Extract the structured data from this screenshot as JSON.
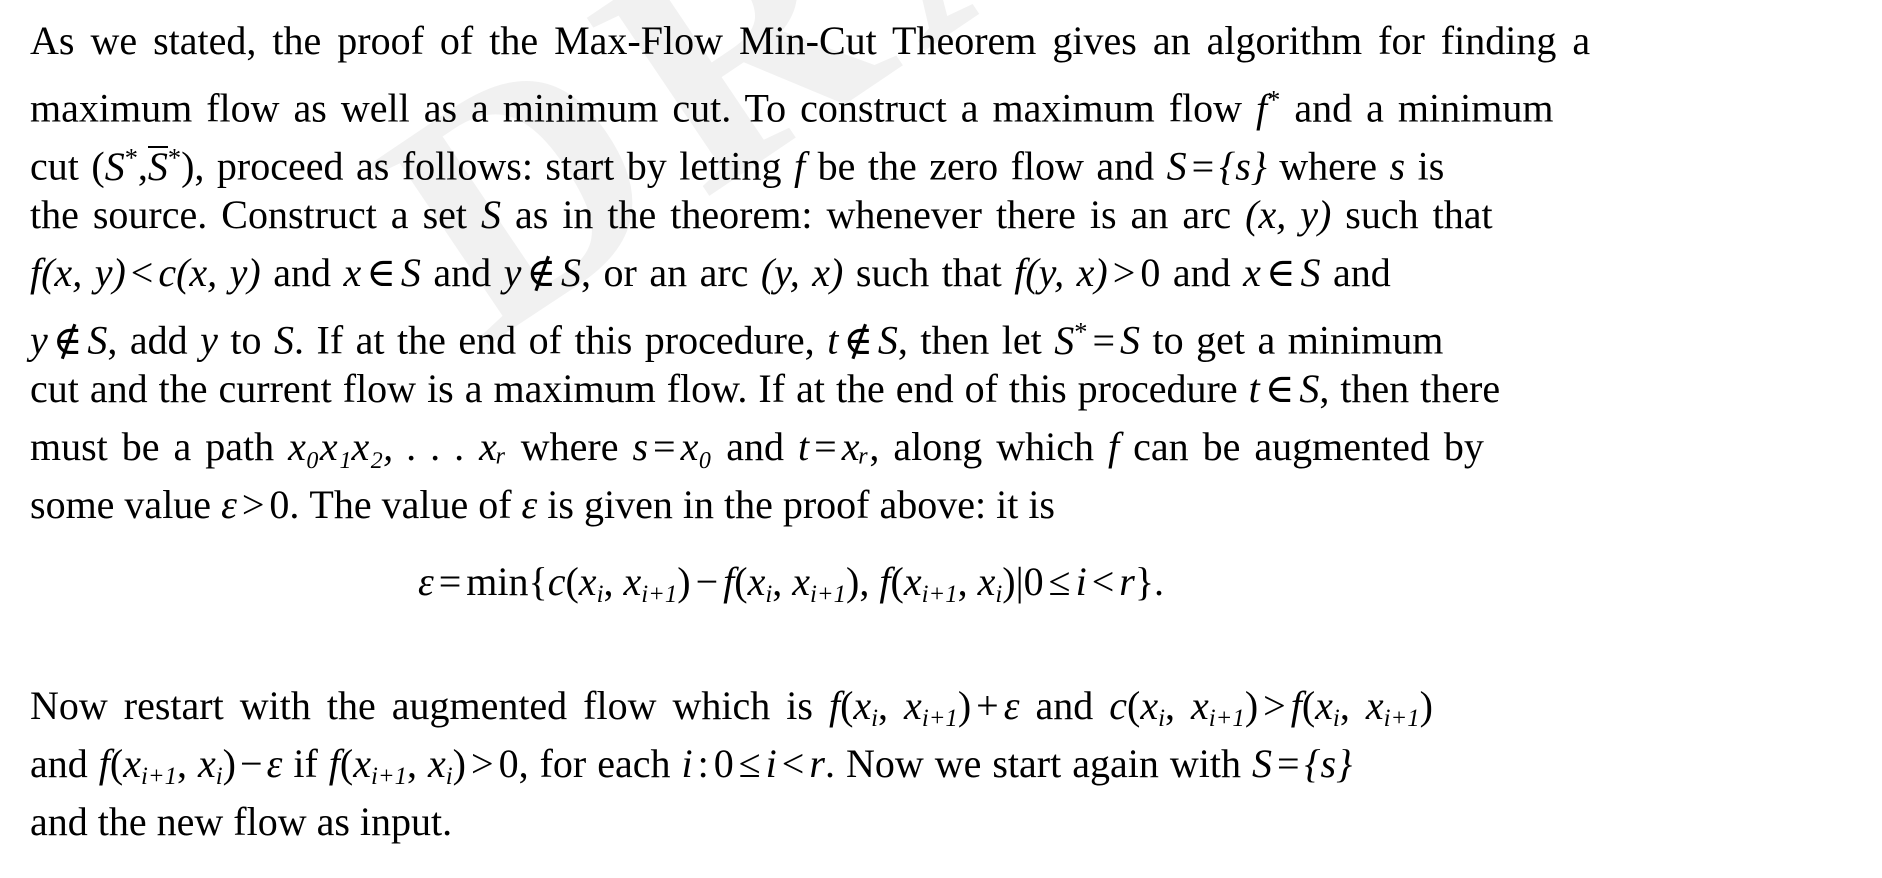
{
  "document": {
    "background_color": "#ffffff",
    "text_color": "#000000",
    "watermark": {
      "text": "DRAFT",
      "color": "#f1f1f1",
      "rotation_degrees": -34
    }
  },
  "paragraph_1": {
    "lines": [
      {
        "id": "p1-l1",
        "text": "As we stated, the proof of the Max-Flow Min-Cut Theorem gives an algorithm for finding a"
      },
      {
        "id": "p1-l2",
        "text": "maximum flow as well as a minimum cut. To construct a maximum flow f* and a minimum"
      },
      {
        "id": "p1-l3",
        "text": "cut (S*, S̅*), proceed as follows: start by letting f be the zero flow and S = {s} where s is"
      },
      {
        "id": "p1-l4",
        "text": "the source. Construct a set S as in the theorem: whenever there is an arc (x, y) such that"
      },
      {
        "id": "p1-l5",
        "text": "f(x, y) < c(x, y) and x ∈ S and y ∉ S, or an arc (y, x) such that f(y, x) > 0 and x ∈ S and"
      },
      {
        "id": "p1-l6",
        "text": "y ∉ S, add y to S. If at the end of this procedure, t ∉ S, then let S* = S to get a minimum"
      },
      {
        "id": "p1-l7",
        "text": "cut and the current flow is a maximum flow. If at the end of this procedure t ∈ S, then there"
      },
      {
        "id": "p1-l8",
        "text": "must be a path x₀x₁x₂, … xᵣ where s = x₀ and t = xᵣ, along which f can be augmented by"
      },
      {
        "id": "p1-l9",
        "text": "some value ε > 0. The value of ε is given in the proof above: it is"
      }
    ],
    "tokens": {
      "l1": {
        "t1": "As we stated, the proof of the Max-Flow Min-Cut Theorem gives an algorithm for finding a"
      },
      "l2": {
        "t1": "maximum flow as well as a minimum cut. To construct a maximum flow",
        "var_f": "f",
        "star": "*",
        "t2": "and a minimum"
      },
      "l3": {
        "t1": "cut (",
        "var_S1": "S",
        "star1": "*",
        "comma": ",",
        "var_S2": "S",
        "star2": "*",
        "t2": "), proceed as follows: start by letting",
        "var_f": "f",
        "t3": "be the zero flow and",
        "var_S3": "S",
        "eq": "=",
        "brace_s": "{s}",
        "t4": "where",
        "var_s": "s",
        "t5": "is"
      },
      "l4": {
        "t1": "the source.  Construct a set",
        "var_S": "S",
        "t2": "as in the theorem:  whenever there is an arc",
        "pair_xy": "(x, y)",
        "t3": "such that"
      },
      "l5": {
        "f_xy": "f(x, y)",
        "lt": "<",
        "c_xy": "c(x, y)",
        "t1": "and",
        "var_x": "x",
        "in1": "∈",
        "var_S1": "S",
        "t2": "and",
        "var_y": "y",
        "notin": "∉",
        "var_S2": "S",
        "t3": ", or an arc",
        "pair_yx": "(y, x)",
        "t4": "such that",
        "f_yx": "f(y, x)",
        "gt": ">",
        "zero": "0",
        "t5": "and",
        "var_x2": "x",
        "in2": "∈",
        "var_S3": "S",
        "t6": "and"
      },
      "l6": {
        "var_y": "y",
        "notin1": "∉",
        "var_S1": "S",
        "t1": ", add",
        "var_y2": "y",
        "t2": "to",
        "var_S2": "S",
        "t3": ". If at the end of this procedure,",
        "var_t": "t",
        "notin2": "∉",
        "var_S3": "S",
        "t4": ", then let",
        "var_Sstar": "S",
        "star": "*",
        "eq": "=",
        "var_S4": "S",
        "t5": "to get a minimum"
      },
      "l7": {
        "t1": "cut and the current flow is a maximum flow.  If at the end of this procedure",
        "var_t": "t",
        "in": "∈",
        "var_S": "S",
        "t2": ", then there"
      },
      "l8": {
        "t1": "must be a path",
        "path": "x₀x₁x₂, . . . xᵣ",
        "t2": "where",
        "var_s": "s",
        "eq1": "=",
        "x0": "x₀",
        "t3": "and",
        "var_t": "t",
        "eq2": "=",
        "xr": "xᵣ",
        "t4": ", along which",
        "var_f": "f",
        "t5": "can be augmented by"
      },
      "l9": {
        "t1": "some value",
        "eps1": "ε",
        "gt": ">",
        "zero": "0",
        "t2": ". The value of",
        "eps2": "ε",
        "t3": "is given in the proof above: it is"
      }
    }
  },
  "equation": {
    "id": "eq-epsilon",
    "plain_text": "ε = min{c(x_i, x_{i+1}) − f(x_i, x_{i+1}), f(x_{i+1}, x_i)|0 ≤ i < r}.",
    "tokens": {
      "eps": "ε",
      "eq": "=",
      "min": "min",
      "open_brace": "{",
      "c": "c",
      "open_paren1": "(",
      "x1": "x",
      "sub_i1": "i",
      "comma1": ",",
      "x2": "x",
      "sub_ip1_1": "i+1",
      "close_paren1": ")",
      "minus": "−",
      "f1": "f",
      "open_paren2": "(",
      "x3": "x",
      "sub_i2": "i",
      "comma2": ",",
      "x4": "x",
      "sub_ip1_2": "i+1",
      "close_paren2": ")",
      "comma3": ",",
      "f2": "f",
      "open_paren3": "(",
      "x5": "x",
      "sub_ip1_3": "i+1",
      "comma4": ",",
      "x6": "x",
      "sub_i3": "i",
      "close_paren3": ")",
      "bar": "|",
      "zero": "0",
      "leq": "≤",
      "i": "i",
      "lt": "<",
      "r": "r",
      "close_brace": "}",
      "period": "."
    }
  },
  "paragraph_2": {
    "lines": [
      {
        "id": "p2-l1",
        "text": "Now restart with the augmented flow which is f(xᵢ, xᵢ₊₁) + ε and c(xᵢ, xᵢ₊₁) > f(xᵢ, xᵢ₊₁)"
      },
      {
        "id": "p2-l2",
        "text": "and f(xᵢ₊₁, xᵢ) − ε if f(xᵢ₊₁, xᵢ) > 0, for each i : 0 ≤ i < r. Now we start again with S = {s}"
      },
      {
        "id": "p2-l3",
        "text": "and the new flow as input."
      }
    ],
    "tokens": {
      "l1": {
        "t1": "Now restart with the augmented flow which is",
        "f1": "f",
        "op1": "(",
        "x1": "x",
        "s1": "i",
        "cm1": ",",
        "x2": "x",
        "s2": "i+1",
        "cp1": ")",
        "plus": "+",
        "eps": "ε",
        "t2": "and",
        "c1": "c",
        "op2": "(",
        "x3": "x",
        "s3": "i",
        "cm2": ",",
        "x4": "x",
        "s4": "i+1",
        "cp2": ")",
        "gt": ">",
        "f2": "f",
        "op3": "(",
        "x5": "x",
        "s5": "i",
        "cm3": ",",
        "x6": "x",
        "s6": "i+1",
        "cp3": ")"
      },
      "l2": {
        "t1": "and",
        "f1": "f",
        "op1": "(",
        "x1": "x",
        "s1": "i+1",
        "cm1": ",",
        "x2": "x",
        "s2": "i",
        "cp1": ")",
        "minus": "−",
        "eps": "ε",
        "t2": "if",
        "f2": "f",
        "op2": "(",
        "x3": "x",
        "s3": "i+1",
        "cm2": ",",
        "x4": "x",
        "s4": "i",
        "cp2": ")",
        "gt": ">",
        "zero": "0",
        "t3": ", for each",
        "var_i": "i",
        "colon": ":",
        "zero2": "0",
        "leq": "≤",
        "var_i2": "i",
        "lt": "<",
        "var_r": "r",
        "t4": ". Now we start again with",
        "var_S": "S",
        "eq": "=",
        "brace_s": "{s}"
      },
      "l3": {
        "t1": "and the new flow as input."
      }
    }
  }
}
